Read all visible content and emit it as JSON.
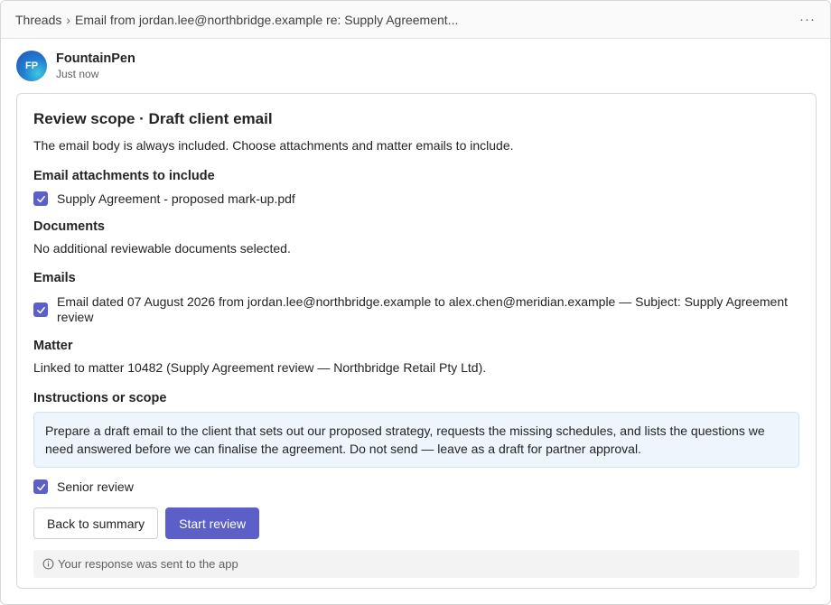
{
  "breadcrumb": {
    "root": "Threads",
    "separator": "›",
    "current": "Email from jordan.lee@northbridge.example re: Supply Agreement..."
  },
  "message": {
    "avatar_initials": "FP",
    "sender": "FountainPen",
    "time": "Just now"
  },
  "card": {
    "title": "Review scope · Draft client email",
    "description": "The email body is always included. Choose attachments and matter emails to include.",
    "attachments": {
      "heading": "Email attachments to include",
      "items": [
        {
          "label": "Supply Agreement - proposed mark-up.pdf",
          "checked": true
        }
      ]
    },
    "documents": {
      "heading": "Documents",
      "text": "No additional reviewable documents selected."
    },
    "emails": {
      "heading": "Emails",
      "items": [
        {
          "label": "Email dated 07 August 2026 from jordan.lee@northbridge.example to alex.chen@meridian.example — Subject: Supply Agreement review",
          "checked": true
        }
      ]
    },
    "matter": {
      "heading": "Matter",
      "text": "Linked to matter 10482 (Supply Agreement review — Northbridge Retail Pty Ltd)."
    },
    "instructions": {
      "heading": "Instructions or scope",
      "text": "Prepare a draft email to the client that sets out our proposed strategy, requests the missing schedules, and lists the questions we need answered before we can finalise the agreement. Do not send — leave as a draft for partner approval."
    },
    "senior_review": {
      "label": "Senior review",
      "checked": true
    },
    "buttons": {
      "back": "Back to summary",
      "start": "Start review"
    },
    "status": {
      "icon": "info-icon",
      "text": "Your response was sent to the app"
    }
  },
  "colors": {
    "accent": "#5b5fc7",
    "instructions_bg": "#eef5fd",
    "status_bg": "#f3f3f3"
  }
}
